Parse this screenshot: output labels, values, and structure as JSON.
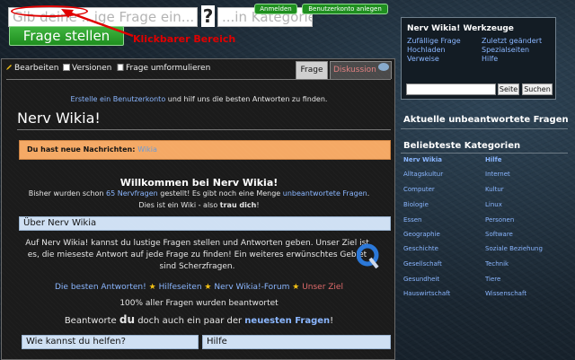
{
  "search": {
    "question_placeholder": "Gib deine ...ige Frage ein...",
    "qmark": "?",
    "category_placeholder": "...in Kategorie",
    "ask_button": "Frage stellen"
  },
  "account": {
    "login": "Anmelden",
    "signup": "Benutzerkonto anlegen"
  },
  "annotation": {
    "label": "Klickbarer Bereich",
    "color": "#e10000"
  },
  "tools": {
    "title": "Nerv Wikia! Werkzeuge",
    "links_left": [
      "Zufällige Frage",
      "Hochladen",
      "Verweise"
    ],
    "links_right": [
      "Zuletzt geändert",
      "Spezialseiten",
      "Hilfe"
    ],
    "search_button": "Seite",
    "search_button2": "Suchen"
  },
  "right": {
    "unanswered_heading": "Aktuelle unbeantwortete Fragen",
    "categories_heading": "Beliebteste Kategorien",
    "categories_left": [
      " Nerv Wikia ",
      "Alltagskultur",
      "Computer",
      "Biologie",
      "Essen",
      "Geographie",
      "Geschichte",
      "Gesellschaft",
      "Gesundheit",
      "Hauswirtschaft"
    ],
    "categories_right": [
      " Hilfe ",
      "Internet",
      "Kultur",
      "Linux",
      "Personen",
      "Software",
      "Soziale Beziehung",
      "Technik",
      "Tiere",
      "Wissenschaft"
    ]
  },
  "toolbar": {
    "edit": "Bearbeiten",
    "versions": "Versionen",
    "rephrase": "Frage umformulieren",
    "tab_question": "Frage",
    "tab_discussion": "Diskussion"
  },
  "content": {
    "signup_link": "Erstelle ein Benutzerkonto",
    "signup_rest": " und hilf uns die besten Antworten zu finden.",
    "title": "Nerv Wikia!",
    "news_label": "Du hast neue Nachrichten:",
    "news_link": "Wikia",
    "welcome": "Willkommen bei Nerv Wikia!",
    "line1_pre": "Bisher wurden schon ",
    "line1_link": "65 Nervfragen",
    "line1_mid": " gestellt! Es gibt noch eine Menge ",
    "line1_link2": "unbeantwortete Fragen",
    "line1_post": ".",
    "line2": "Dies ist ein Wiki - also ",
    "line2_bold": "trau dich",
    "line2_post": "!",
    "about_head": "Über Nerv Wikia",
    "about_text": "Auf Nerv Wikia! kannst du lustige Fragen stellen und Antworten geben. Unser Ziel ist es, die mieseste Antwort auf jede Frage zu finden! Ein weiteres erwünschtes Gebiet sind Scherzfragen.",
    "links_row": [
      "Die besten Antworten!",
      "Hilfeseiten",
      "Nerv Wikia!-Forum",
      "Unser Ziel"
    ],
    "answered": "100% aller Fragen wurden beantwortet",
    "answer_pre": "Beantworte ",
    "answer_du": "du",
    "answer_mid": " doch auch ein paar der ",
    "answer_link": "neuesten Fragen",
    "answer_post": "!",
    "help_head": "Wie kannst du helfen?",
    "hilfe_head": "Hilfe"
  }
}
